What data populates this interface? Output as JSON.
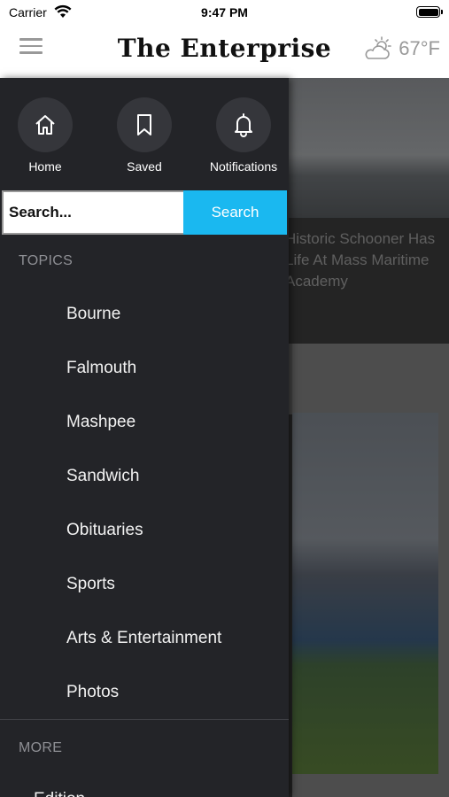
{
  "status_bar": {
    "carrier": "Carrier",
    "time": "9:47 PM"
  },
  "header": {
    "title": "The Enterprise",
    "temperature": "67°F",
    "weather_icon": "partly-cloudy-icon"
  },
  "background": {
    "caption": "Historic Schooner Has Life At Mass Maritime Academy"
  },
  "drawer": {
    "quick_links": [
      {
        "label": "Home",
        "icon": "home-icon"
      },
      {
        "label": "Saved",
        "icon": "bookmark-icon"
      },
      {
        "label": "Notifications",
        "icon": "bell-icon"
      }
    ],
    "search": {
      "placeholder": "Search...",
      "button_label": "Search"
    },
    "topics_heading": "TOPICS",
    "topics": [
      "Bourne",
      "Falmouth",
      "Mashpee",
      "Sandwich",
      "Obituaries",
      "Sports",
      "Arts & Entertainment",
      "Photos"
    ],
    "more_heading": "MORE",
    "more_items": [
      "Edition"
    ]
  },
  "colors": {
    "accent": "#1ab8f0",
    "drawer_bg": "#232428"
  }
}
